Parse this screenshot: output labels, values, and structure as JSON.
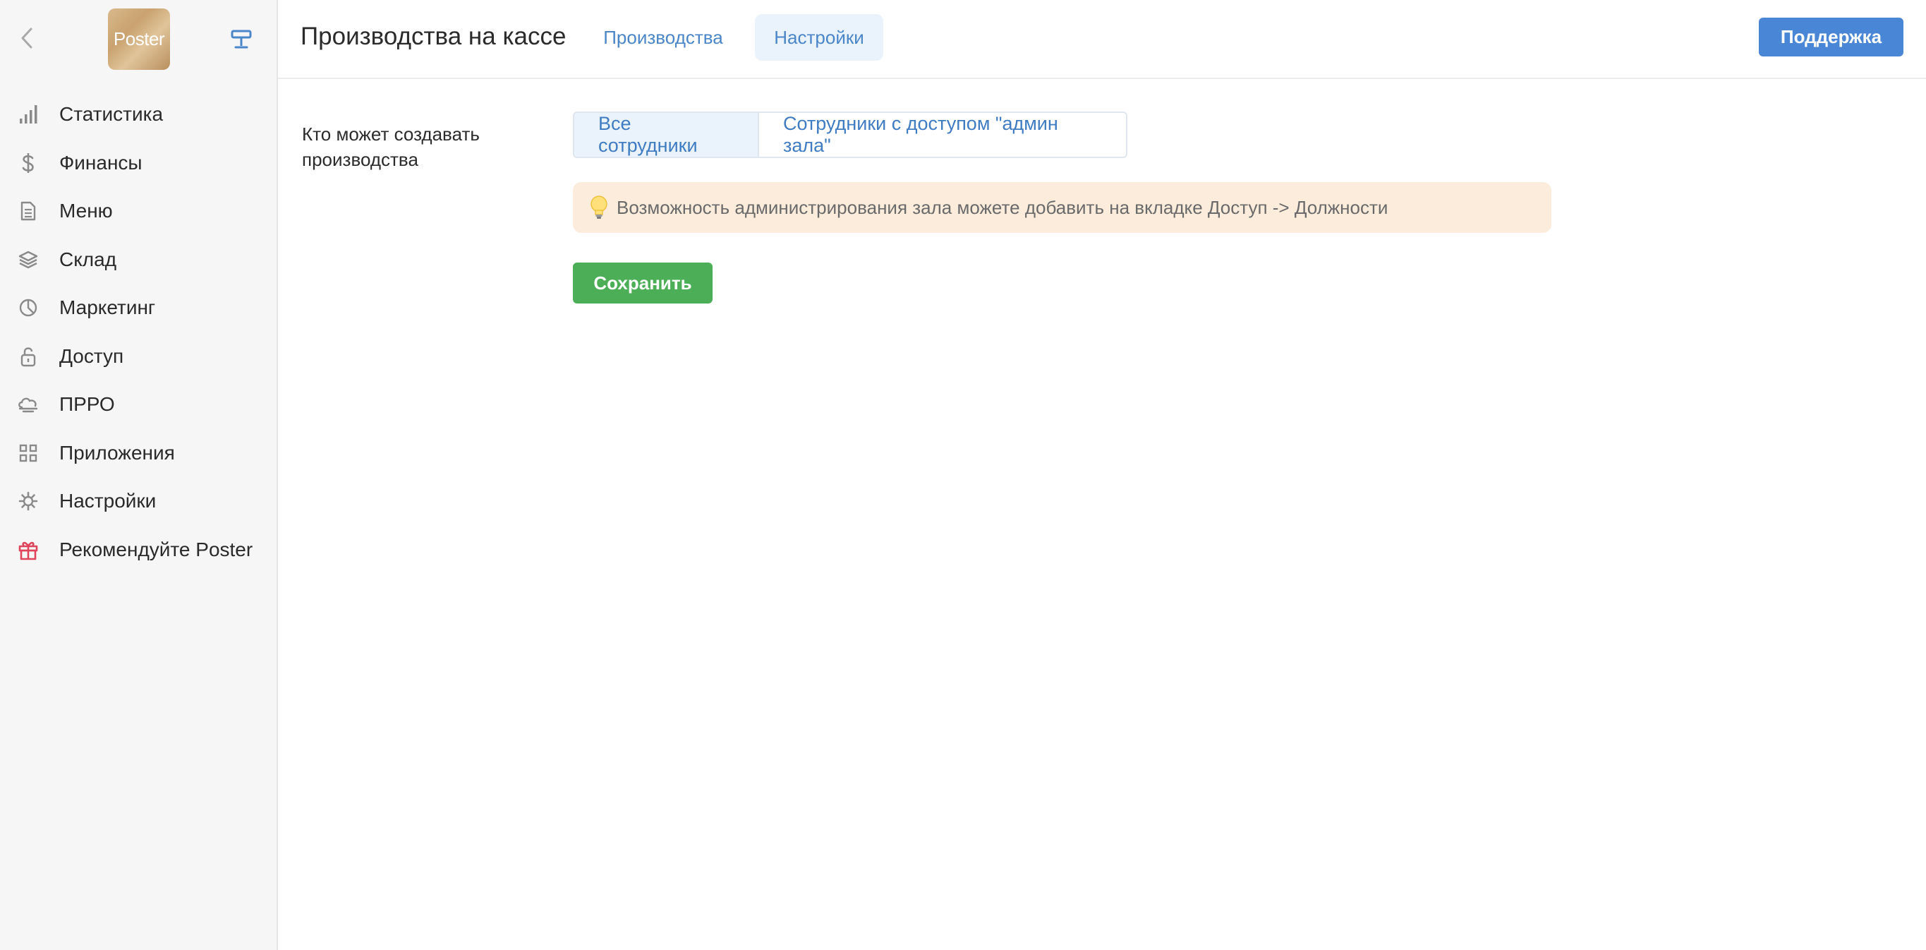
{
  "app": {
    "logo_text": "Poster"
  },
  "sidebar": {
    "items": [
      {
        "label": "Статистика",
        "icon": "bar-chart-icon"
      },
      {
        "label": "Финансы",
        "icon": "dollar-icon"
      },
      {
        "label": "Меню",
        "icon": "document-icon"
      },
      {
        "label": "Склад",
        "icon": "layers-icon"
      },
      {
        "label": "Маркетинг",
        "icon": "pie-chart-icon"
      },
      {
        "label": "Доступ",
        "icon": "lock-icon"
      },
      {
        "label": "ПРРО",
        "icon": "cloud-icon"
      },
      {
        "label": "Приложения",
        "icon": "grid-icon"
      },
      {
        "label": "Настройки",
        "icon": "gear-icon"
      },
      {
        "label": "Рекомендуйте Poster",
        "icon": "gift-icon"
      }
    ]
  },
  "header": {
    "title": "Производства на кассе",
    "tabs": [
      {
        "label": "Производства",
        "active": false
      },
      {
        "label": "Настройки",
        "active": true
      }
    ],
    "support_label": "Поддержка"
  },
  "form": {
    "field_label": "Кто может создавать производства",
    "options": [
      {
        "label": "Все сотрудники",
        "selected": true
      },
      {
        "label": "Сотрудники с доступом \"админ зала\"",
        "selected": false
      }
    ],
    "hint": "Возможность администрирования зала можете добавить на вкладке Доступ -> Должности",
    "save_label": "Сохранить"
  },
  "colors": {
    "accent": "#4a86d6",
    "save": "#4caf58",
    "hint_bg": "#fbecdc",
    "gift": "#e0455c"
  }
}
